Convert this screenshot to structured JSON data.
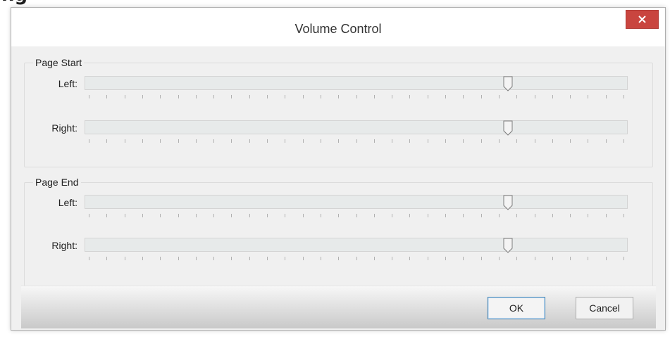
{
  "window": {
    "title": "Volume Control"
  },
  "groups": [
    {
      "label": "Page Start",
      "sliders": [
        {
          "label": "Left:",
          "value_fraction": 0.78
        },
        {
          "label": "Right:",
          "value_fraction": 0.78
        }
      ]
    },
    {
      "label": "Page End",
      "sliders": [
        {
          "label": "Left:",
          "value_fraction": 0.78
        },
        {
          "label": "Right:",
          "value_fraction": 0.78
        }
      ]
    }
  ],
  "buttons": {
    "ok": "OK",
    "cancel": "Cancel"
  },
  "icons": {
    "close": "close-icon",
    "thumb": "slider-thumb-icon"
  },
  "colors": {
    "close_button": "#c9453f",
    "default_button_border": "#3c7fb1"
  }
}
